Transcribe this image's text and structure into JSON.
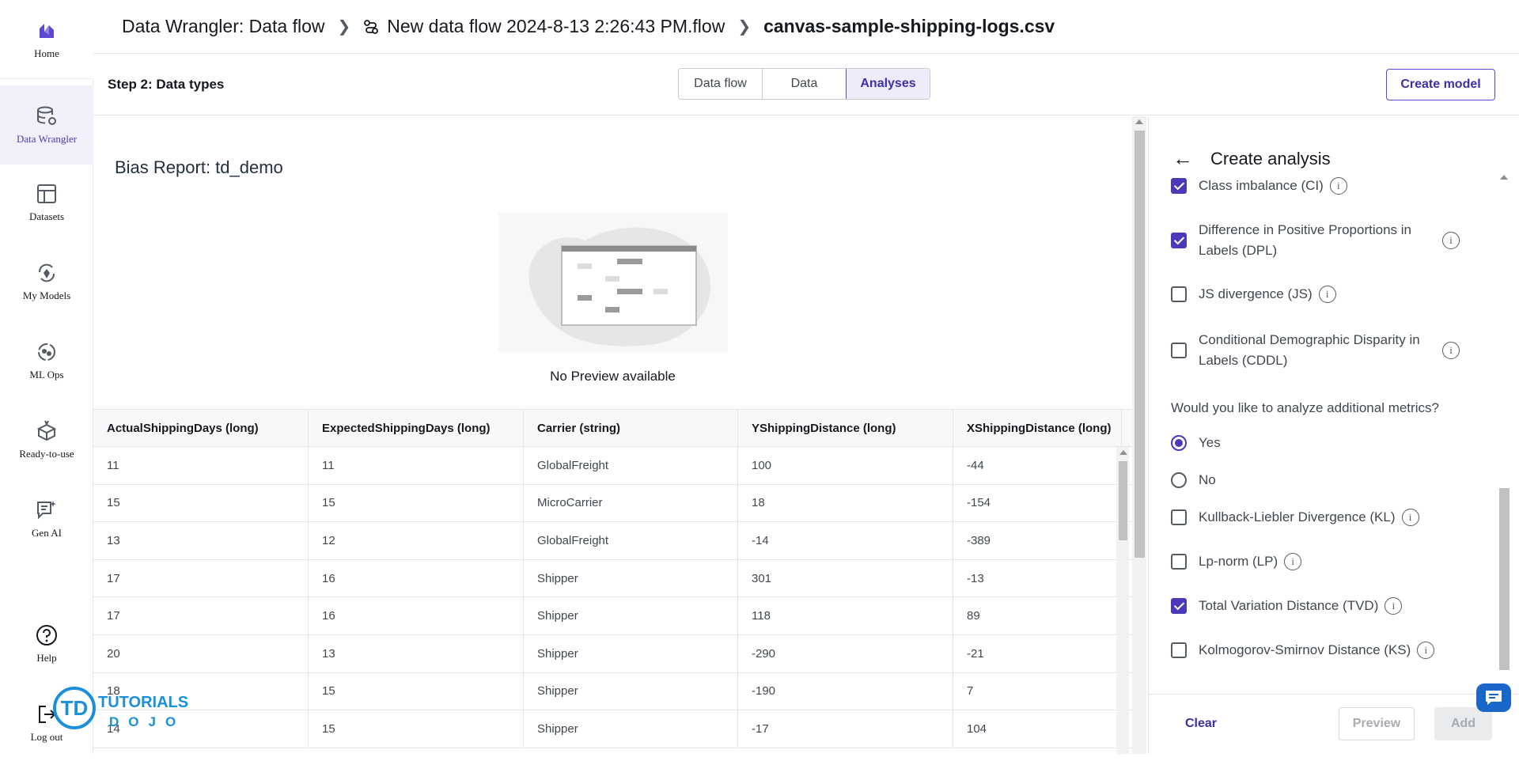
{
  "nav": {
    "home": "Home",
    "data_wrangler": "Data Wrangler",
    "datasets": "Datasets",
    "my_models": "My Models",
    "ml_ops": "ML Ops",
    "ready_to_use": "Ready-to-use",
    "gen_ai": "Gen AI",
    "help": "Help",
    "log_out": "Log out"
  },
  "breadcrumb": {
    "root": "Data Wrangler: Data flow",
    "flow": "New data flow 2024-8-13 2:26:43 PM.flow",
    "file": "canvas-sample-shipping-logs.csv"
  },
  "step": {
    "title": "Step 2: Data types",
    "tabs": [
      "Data flow",
      "Data",
      "Analyses"
    ],
    "active_tab": "Analyses",
    "create_model": "Create model"
  },
  "report": {
    "title": "Bias Report: td_demo",
    "no_preview": "No Preview available"
  },
  "table": {
    "headers": [
      "ActualShippingDays (long)",
      "ExpectedShippingDays (long)",
      "Carrier (string)",
      "YShippingDistance (long)",
      "XShippingDistance (long)"
    ],
    "rows": [
      [
        "11",
        "11",
        "GlobalFreight",
        "100",
        "-44"
      ],
      [
        "15",
        "15",
        "MicroCarrier",
        "18",
        "-154"
      ],
      [
        "13",
        "12",
        "GlobalFreight",
        "-14",
        "-389"
      ],
      [
        "17",
        "16",
        "Shipper",
        "301",
        "-13"
      ],
      [
        "17",
        "16",
        "Shipper",
        "118",
        "89"
      ],
      [
        "20",
        "13",
        "Shipper",
        "-290",
        "-21"
      ],
      [
        "18",
        "15",
        "Shipper",
        "-190",
        "7"
      ],
      [
        "14",
        "15",
        "Shipper",
        "-17",
        "104"
      ]
    ]
  },
  "panel": {
    "title": "Create analysis",
    "metrics": [
      {
        "label": "Class imbalance (CI)",
        "checked": true
      },
      {
        "label": "Difference in Positive Proportions in Labels (DPL)",
        "checked": true
      },
      {
        "label": "JS divergence (JS)",
        "checked": false
      },
      {
        "label": "Conditional Demographic Disparity in Labels (CDDL)",
        "checked": false
      }
    ],
    "question": "Would you like to analyze additional metrics?",
    "yes": "Yes",
    "no": "No",
    "additional": [
      {
        "label": "Kullback-Liebler Divergence (KL)",
        "checked": false
      },
      {
        "label": "Lp-norm (LP)",
        "checked": false
      },
      {
        "label": "Total Variation Distance (TVD)",
        "checked": true
      },
      {
        "label": "Kolmogorov-Smirnov Distance (KS)",
        "checked": false
      }
    ],
    "clear": "Clear",
    "preview": "Preview",
    "add": "Add"
  },
  "watermark": {
    "brand": "TUTORIALS",
    "sub": "DOJO",
    "logo": "TD"
  },
  "colors": {
    "accent": "#4b3ab8",
    "chat": "#1b66c9",
    "watermark": "#1b8fd8"
  }
}
